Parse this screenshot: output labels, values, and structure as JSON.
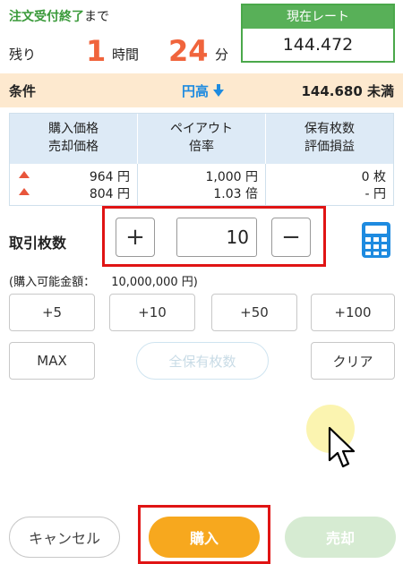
{
  "header": {
    "deadline_strong": "注文受付終了",
    "deadline_rest": "まで",
    "remaining_label": "残り",
    "hours": "1",
    "hours_unit": "時間",
    "minutes": "24",
    "minutes_unit": "分"
  },
  "rate": {
    "label": "現在レート",
    "value": "144.472"
  },
  "condition": {
    "label": "条件",
    "direction": "円高",
    "direction_icon": "down-arrow-icon",
    "value": "144.680 未満"
  },
  "table": {
    "headers": [
      [
        "購入価格",
        "売却価格"
      ],
      [
        "ペイアウト",
        "倍率"
      ],
      [
        "保有枚数",
        "評価損益"
      ]
    ],
    "col1": [
      "964 円",
      "804 円"
    ],
    "col2": [
      "1,000 円",
      "1.03 倍"
    ],
    "col3": [
      "0 枚",
      "- 円"
    ]
  },
  "quantity": {
    "label": "取引枚数",
    "value": "10",
    "plus": "+",
    "minus": "−"
  },
  "buyable": {
    "label": "(購入可能金額：",
    "value": "10,000,000 円)"
  },
  "amount_buttons": [
    "+5",
    "+10",
    "+50",
    "+100"
  ],
  "row2_buttons": {
    "max": "MAX",
    "all": "全保有枚数",
    "clear": "クリア"
  },
  "actions": {
    "cancel": "キャンセル",
    "buy": "購入",
    "sell": "売却"
  },
  "colors": {
    "accent_green": "#58b058",
    "highlight_red": "#e01414",
    "buy_orange": "#f7a81e",
    "number_orange": "#f0643c",
    "blue": "#1e8be0"
  }
}
